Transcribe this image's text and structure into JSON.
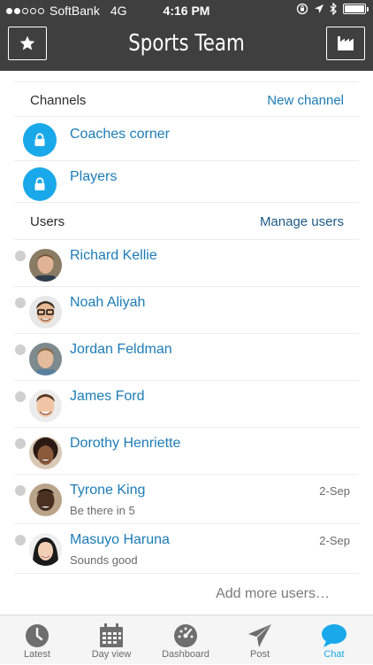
{
  "status_bar": {
    "carrier": "SoftBank",
    "network": "4G",
    "time": "4:16 PM"
  },
  "header": {
    "title": "Sports Team",
    "left_icon": "star-icon",
    "right_icon": "factory-icon"
  },
  "channels": {
    "section_label": "Channels",
    "action_label": "New channel",
    "items": [
      {
        "name": "Coaches corner",
        "icon": "lock-icon"
      },
      {
        "name": "Players",
        "icon": "lock-icon"
      }
    ]
  },
  "users": {
    "section_label": "Users",
    "action_label": "Manage users",
    "items": [
      {
        "name": "Richard Kellie",
        "message": "",
        "date": ""
      },
      {
        "name": "Noah Aliyah",
        "message": "",
        "date": ""
      },
      {
        "name": "Jordan Feldman",
        "message": "",
        "date": ""
      },
      {
        "name": "James Ford",
        "message": "",
        "date": ""
      },
      {
        "name": "Dorothy Henriette",
        "message": "",
        "date": ""
      },
      {
        "name": "Tyrone King",
        "message": "Be there in 5",
        "date": "2-Sep"
      },
      {
        "name": "Masuyo Haruna",
        "message": "Sounds good",
        "date": "2-Sep"
      }
    ],
    "add_more_label": "Add more users…"
  },
  "tab_bar": {
    "tabs": [
      {
        "label": "Latest",
        "icon": "clock-icon"
      },
      {
        "label": "Day view",
        "icon": "calendar-icon"
      },
      {
        "label": "Dashboard",
        "icon": "dashboard-icon"
      },
      {
        "label": "Post",
        "icon": "paper-plane-icon"
      },
      {
        "label": "Chat",
        "icon": "chat-bubble-icon"
      }
    ],
    "active_tab": "Chat"
  },
  "colors": {
    "header_bg": "#3f3f3f",
    "link_blue": "#1c7cb6",
    "accent_cyan": "#19a9ea",
    "presence_gray": "#cfcfcf",
    "section_action_dark": "#1c5a86"
  }
}
